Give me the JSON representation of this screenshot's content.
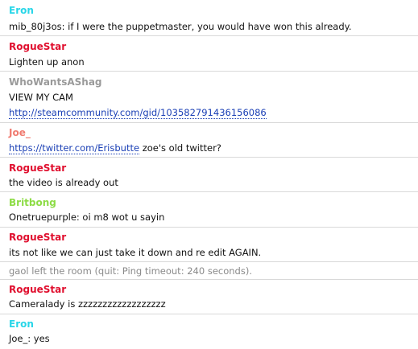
{
  "messages": [
    {
      "nick": "Eron",
      "color": "#29d6e8",
      "text": "mib_80j3os: if I were the puppetmaster, you would have won this already."
    },
    {
      "nick": "RogueStar",
      "color": "#e0102f",
      "text": "Lighten up anon"
    },
    {
      "nick": "WhoWantsAShag",
      "color": "#9a9a9a",
      "text": "VIEW MY CAM",
      "link": "http://steamcommunity.com/gid/103582791436156086"
    },
    {
      "nick": "Joe_",
      "color": "#f07b70",
      "link": "https://twitter.com/Erisbutte",
      "text": " zoe's old twitter?"
    },
    {
      "nick": "RogueStar",
      "color": "#e0102f",
      "text": "the video is already out"
    },
    {
      "nick": "Britbong",
      "color": "#8ddc46",
      "text": "Onetruepurple: oi m8 wot u sayin"
    },
    {
      "nick": "RogueStar",
      "color": "#e0102f",
      "text": "its not like we can just take it down and re edit AGAIN."
    },
    {
      "system": "gaol left the room (quit: Ping timeout: 240 seconds)."
    },
    {
      "nick": "RogueStar",
      "color": "#e0102f",
      "text": "Cameralady is zzzzzzzzzzzzzzzzzz"
    },
    {
      "nick": "Eron",
      "color": "#29d6e8",
      "text": "Joe_: yes"
    }
  ]
}
